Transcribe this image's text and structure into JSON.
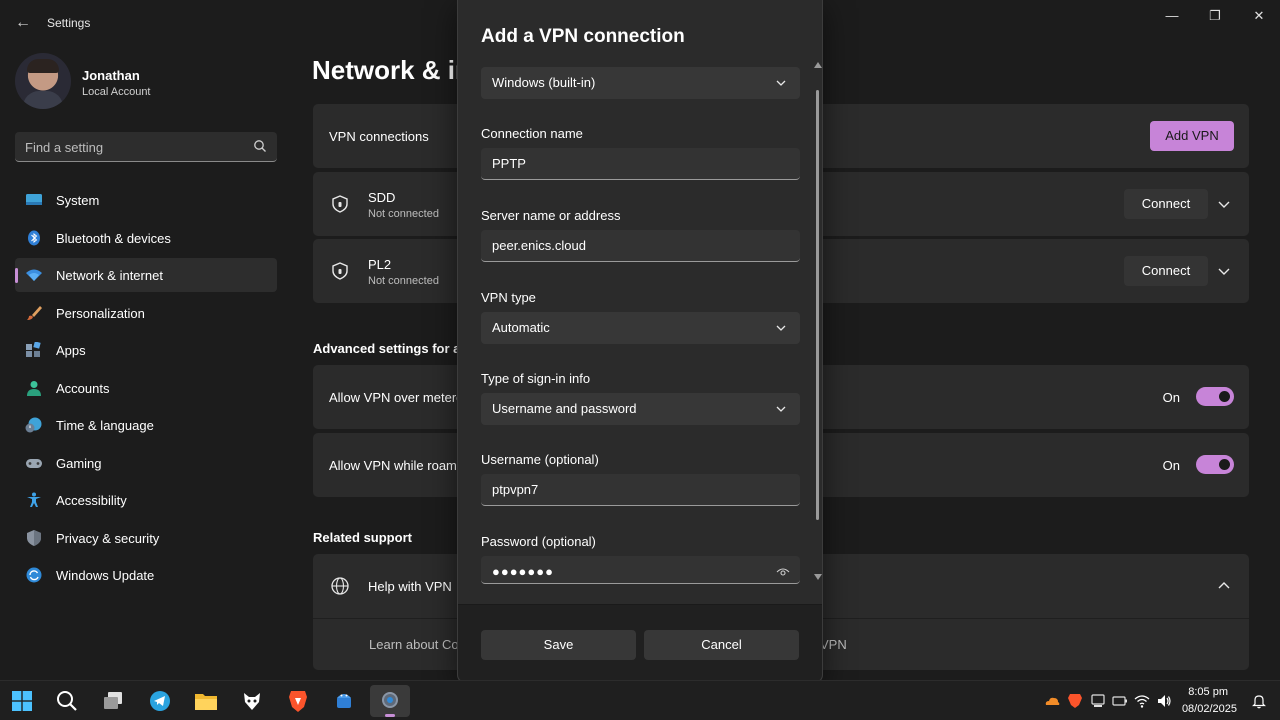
{
  "window": {
    "title": "Settings",
    "back_glyph": "←",
    "minimize_glyph": "—",
    "maximize_glyph": "❐",
    "close_glyph": "✕"
  },
  "profile": {
    "name": "Jonathan",
    "account_type": "Local Account"
  },
  "search": {
    "placeholder": "Find a setting",
    "icon": "search-icon"
  },
  "sidebar": {
    "items": [
      {
        "label": "System",
        "icon": "system-icon",
        "active": false
      },
      {
        "label": "Bluetooth & devices",
        "icon": "bluetooth-icon",
        "active": false
      },
      {
        "label": "Network & internet",
        "icon": "wifi-icon",
        "active": true
      },
      {
        "label": "Personalization",
        "icon": "brush-icon",
        "active": false
      },
      {
        "label": "Apps",
        "icon": "apps-icon",
        "active": false
      },
      {
        "label": "Accounts",
        "icon": "accounts-icon",
        "active": false
      },
      {
        "label": "Time & language",
        "icon": "time-language-icon",
        "active": false
      },
      {
        "label": "Gaming",
        "icon": "gamepad-icon",
        "active": false
      },
      {
        "label": "Accessibility",
        "icon": "accessibility-icon",
        "active": false
      },
      {
        "label": "Privacy & security",
        "icon": "shield-icon",
        "active": false
      },
      {
        "label": "Windows Update",
        "icon": "update-icon",
        "active": false
      }
    ]
  },
  "main": {
    "page_title": "Network & in",
    "vpn_connections_label": "VPN connections",
    "add_vpn_label": "Add VPN",
    "connections": [
      {
        "name": "SDD",
        "status": "Not connected",
        "button": "Connect"
      },
      {
        "name": "PL2",
        "status": "Not connected",
        "button": "Connect"
      }
    ],
    "advanced_title": "Advanced settings for al",
    "settings": [
      {
        "label": "Allow VPN over metere",
        "state": "On"
      },
      {
        "label": "Allow VPN while roam",
        "state": "On"
      }
    ],
    "related_title": "Related support",
    "help_label": "Help with VPN",
    "learn_left": "Learn about Co",
    "learn_right": "VPN"
  },
  "dialog": {
    "title": "Add a VPN connection",
    "provider": "Windows (built-in)",
    "connection_name_label": "Connection name",
    "connection_name_value": "PPTP",
    "server_label": "Server name or address",
    "server_value": "peer.enics.cloud",
    "vpn_type_label": "VPN type",
    "vpn_type_value": "Automatic",
    "signin_label": "Type of sign-in info",
    "signin_value": "Username and password",
    "username_label": "Username (optional)",
    "username_value": "ptpvpn7",
    "password_label": "Password (optional)",
    "password_value": "●●●●●●●",
    "save_label": "Save",
    "cancel_label": "Cancel"
  },
  "taskbar": {
    "apps": [
      "start-icon",
      "search-icon",
      "task-view-icon",
      "telegram-icon",
      "file-explorer-icon",
      "browser-icon",
      "brave-icon",
      "android-studio-icon",
      "settings-icon"
    ],
    "time": "8:05 pm",
    "date": "08/02/2025"
  },
  "colors": {
    "accent": "#c784d8",
    "background": "#1c1c1c",
    "card": "#2b2b2b"
  }
}
